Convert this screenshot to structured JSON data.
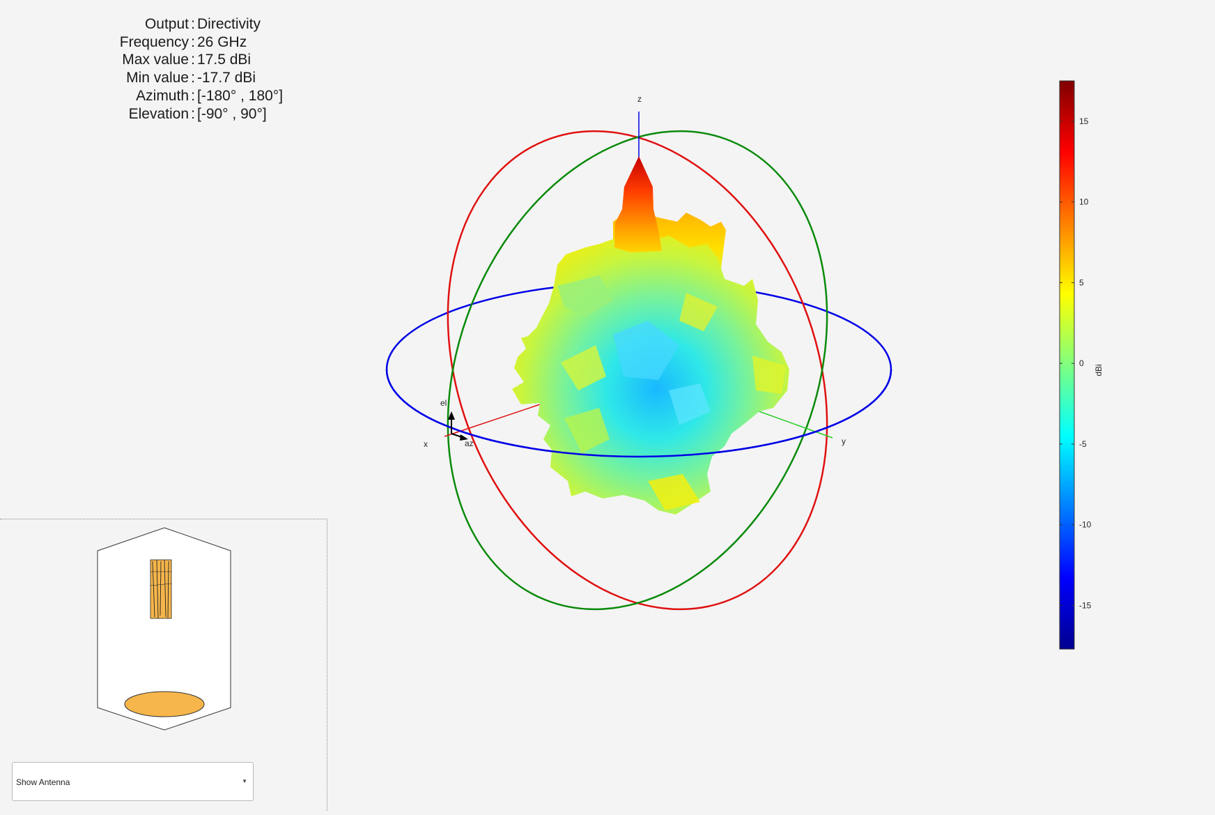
{
  "info": {
    "rows": [
      {
        "label": "Output",
        "value": "Directivity"
      },
      {
        "label": "Frequency",
        "value": "26 GHz"
      },
      {
        "label": "Max value",
        "value": "17.5 dBi"
      },
      {
        "label": "Min value",
        "value": "-17.7 dBi"
      },
      {
        "label": "Azimuth",
        "value": "[-180° , 180°]"
      },
      {
        "label": "Elevation",
        "value": "[-90° , 90°]"
      }
    ]
  },
  "axes": {
    "x": "x",
    "y": "y",
    "z": "z",
    "az": "az",
    "el": "el"
  },
  "colorbar": {
    "label": "dBi",
    "min": -17.7,
    "max": 17.5,
    "ticks": [
      "15",
      "10",
      "5",
      "0",
      "-5",
      "-10",
      "-15"
    ],
    "tick_values": [
      15,
      10,
      5,
      0,
      -5,
      -10,
      -15
    ]
  },
  "colors": {
    "azimuth_circle": "#0000e6",
    "elevation_circle_xz": "#e01010",
    "elevation_circle_yz": "#0a8a0a",
    "antenna_fill": "#f6b64c"
  },
  "dropdown": {
    "selected": "Show Antenna"
  }
}
